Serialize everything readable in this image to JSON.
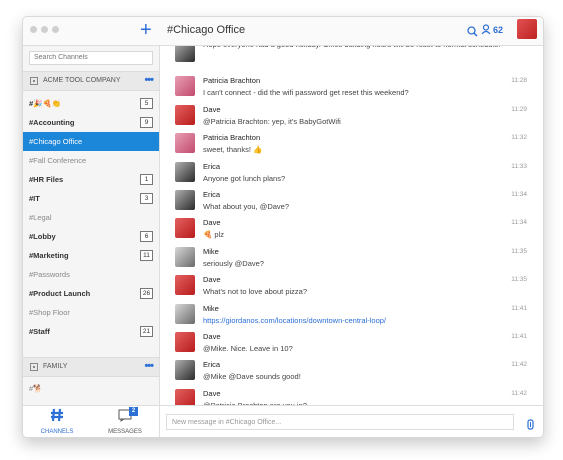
{
  "header": {
    "channel_title": "#Chicago Office",
    "member_count": "62"
  },
  "sidebar": {
    "search_placeholder": "Search Channels",
    "teams": [
      {
        "name": "ACME TOOL COMPANY",
        "more": "•••"
      },
      {
        "name": "FAMILY",
        "more": "•••"
      }
    ],
    "channels": [
      {
        "name": "#🎉🍕👏",
        "badge": "5",
        "style": "bold"
      },
      {
        "name": "#Accounting",
        "badge": "9",
        "style": "bold"
      },
      {
        "name": "#Chicago Office",
        "badge": "",
        "style": "active"
      },
      {
        "name": "#Fall Conference",
        "badge": "",
        "style": "muted"
      },
      {
        "name": "#HR Files",
        "badge": "1",
        "style": "bold"
      },
      {
        "name": "#IT",
        "badge": "3",
        "style": "bold"
      },
      {
        "name": "#Legal",
        "badge": "",
        "style": "muted"
      },
      {
        "name": "#Lobby",
        "badge": "6",
        "style": "bold"
      },
      {
        "name": "#Marketing",
        "badge": "11",
        "style": "bold"
      },
      {
        "name": "#Passwords",
        "badge": "",
        "style": "muted"
      },
      {
        "name": "#Product Launch",
        "badge": "26",
        "style": "bold"
      },
      {
        "name": "#Shop Floor",
        "badge": "",
        "style": "muted"
      },
      {
        "name": "#Staff",
        "badge": "21",
        "style": "bold"
      }
    ],
    "family_channels": [
      {
        "name": "#🐕",
        "style": "muted"
      }
    ]
  },
  "bottom_nav": {
    "channels_label": "CHANNELS",
    "messages_label": "MESSAGES",
    "messages_badge": "2"
  },
  "messages": [
    {
      "author": "",
      "text": "Hope everyone had a good holiday. Office building hours will be reset to normal schedule.",
      "time": "",
      "avatar": "gray"
    },
    {
      "author": "Patricia Brachton",
      "text": "I can't connect - did the wifi password get reset this weekend?",
      "time": "11:28",
      "avatar": "pink"
    },
    {
      "author": "Dave",
      "text": "@Patricia Brachton: yep, it's BabyGotWifi",
      "time": "11:29",
      "avatar": "red"
    },
    {
      "author": "Patricia Brachton",
      "text": "sweet, thanks! 👍",
      "time": "11:32",
      "avatar": "pink"
    },
    {
      "author": "Erica",
      "text": "Anyone got lunch plans?",
      "time": "11:33",
      "avatar": "gray"
    },
    {
      "author": "Erica",
      "text": "What about you, @Dave?",
      "time": "11:34",
      "avatar": "gray"
    },
    {
      "author": "Dave",
      "text": "🍕 plz",
      "time": "11:34",
      "avatar": "red"
    },
    {
      "author": "Mike",
      "text": "seriously @Dave?",
      "time": "11:35",
      "avatar": "photo"
    },
    {
      "author": "Dave",
      "text": "What's not to love about pizza?",
      "time": "11:35",
      "avatar": "red"
    },
    {
      "author": "Mike",
      "text": "https://giordanos.com/locations/downtown-central-loop/",
      "time": "11:41",
      "avatar": "photo",
      "link": true
    },
    {
      "author": "Dave",
      "text": "@Mike. Nice. Leave in 10?",
      "time": "11:41",
      "avatar": "red"
    },
    {
      "author": "Erica",
      "text": "@Mike @Dave sounds good!",
      "time": "11:42",
      "avatar": "gray"
    },
    {
      "author": "Dave",
      "text": "@Patricia Brachton are you in?",
      "time": "11:42",
      "avatar": "red"
    }
  ],
  "composer": {
    "placeholder": "New message in #Chicago Office..."
  },
  "colors": {
    "accent": "#2c6fd6",
    "active_channel": "#1c86d8"
  }
}
